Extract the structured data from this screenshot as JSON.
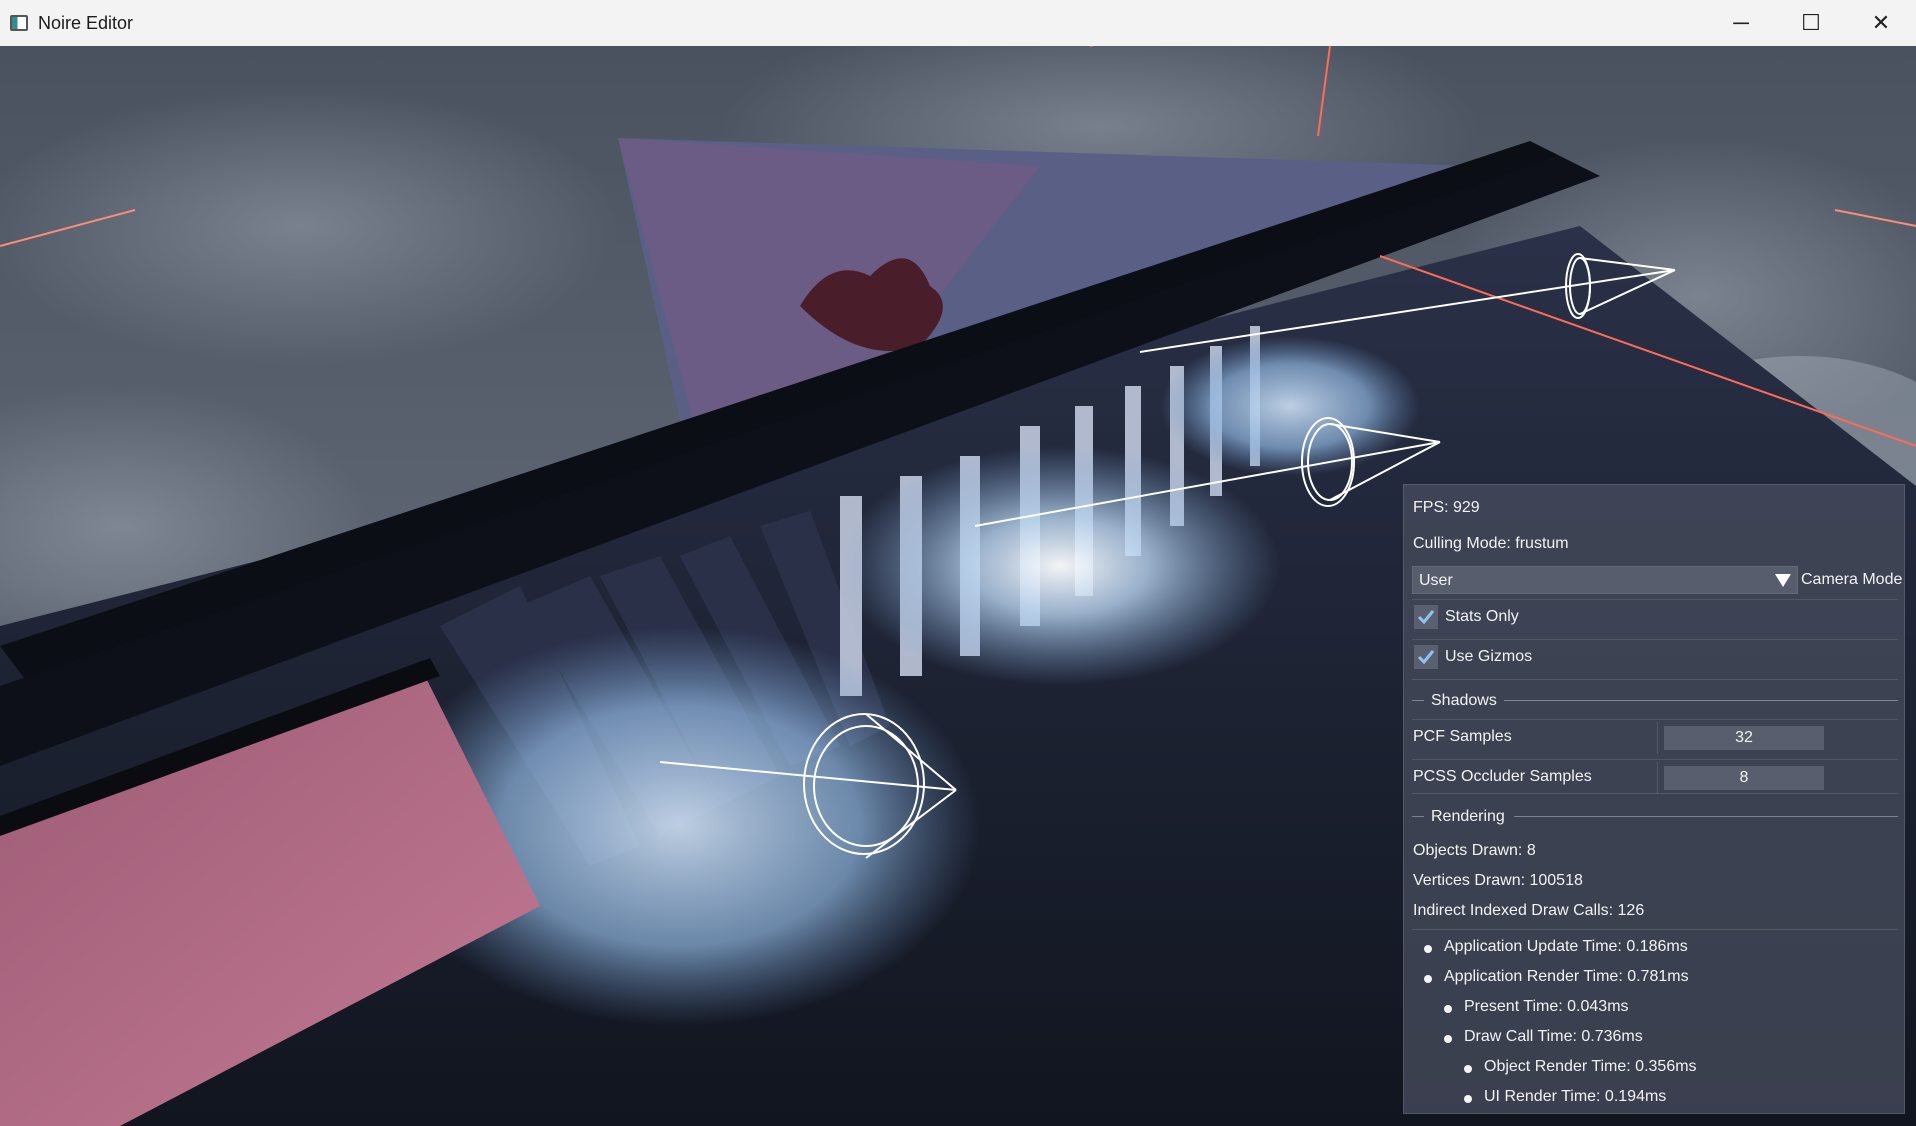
{
  "window": {
    "title": "Noire Editor",
    "minimize_glyph": "─",
    "maximize_glyph": "☐",
    "close_glyph": "✕"
  },
  "stats": {
    "fps": "FPS: 929",
    "culling": "Culling Mode: frustum",
    "camera_select": {
      "value": "User",
      "label": "Camera Mode"
    },
    "stats_only": {
      "label": "Stats Only",
      "checked": true
    },
    "use_gizmos": {
      "label": "Use Gizmos",
      "checked": true
    },
    "shadows": {
      "header": "Shadows",
      "pcf_label": "PCF Samples",
      "pcf_value": "32",
      "pcss_label": "PCSS Occluder Samples",
      "pcss_value": "8"
    },
    "rendering": {
      "header": "Rendering",
      "objects": "Objects Drawn: 8",
      "vertices": "Vertices Drawn: 100518",
      "draw_calls": "Indirect Indexed Draw Calls: 126",
      "timings": [
        "Application Update Time: 0.186ms",
        "Application Render Time: 0.781ms",
        "Present Time: 0.043ms",
        "Draw Call Time: 0.736ms",
        "Object Render Time: 0.356ms",
        "UI Render Time: 0.194ms"
      ]
    }
  },
  "icons": [
    "app-icon",
    "minimize-icon",
    "maximize-icon",
    "close-icon",
    "dropdown-arrow-icon",
    "checkmark-icon",
    "bullet-icon",
    "spotlight-gizmo-icon"
  ],
  "colors": {
    "accent_check": "#8fc3f0",
    "panel_bg": "#464c5c",
    "titlebar_bg": "#f3f3f3"
  }
}
